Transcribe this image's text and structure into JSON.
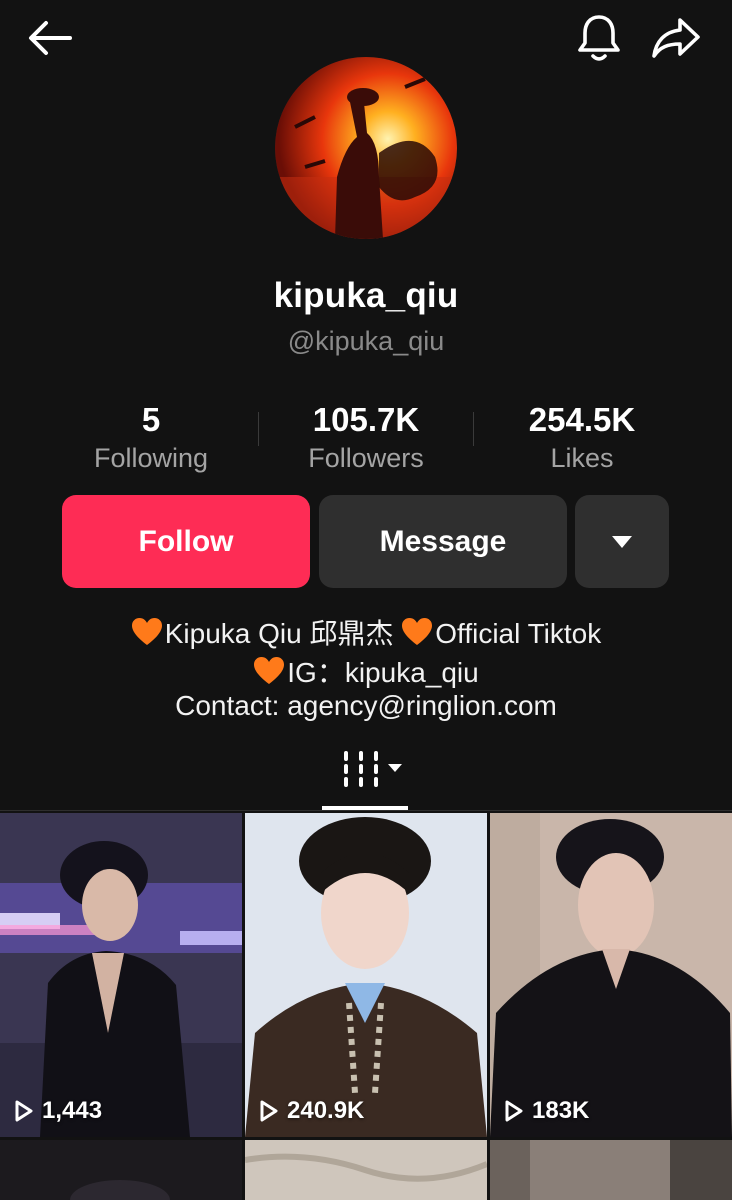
{
  "profile": {
    "display_name": "kipuka_qiu",
    "handle": "@kipuka_qiu"
  },
  "stats": [
    {
      "value": "5",
      "label": "Following"
    },
    {
      "value": "105.7K",
      "label": "Followers"
    },
    {
      "value": "254.5K",
      "label": "Likes"
    }
  ],
  "actions": {
    "follow_label": "Follow",
    "message_label": "Message"
  },
  "bio": {
    "line1": "Kipuka Qiu 邱鼎杰 ",
    "line1_tail": "Official Tiktok",
    "line2": "IG：kipuka_qiu",
    "line3": "Contact: agency@ringlion.com"
  },
  "videos": [
    {
      "views": "1,443"
    },
    {
      "views": "240.9K"
    },
    {
      "views": "183K"
    }
  ],
  "icons": {
    "back": "arrow-left-icon",
    "bell": "bell-icon",
    "share": "share-icon",
    "more": "caret-down-icon",
    "grid": "grid-icon",
    "play": "play-icon",
    "heart": "orange-heart-icon"
  },
  "colors": {
    "background": "#121212",
    "follow": "#fe2c55",
    "secondary_button": "#2f2f2f",
    "muted_text": "#8a8a8a",
    "heart": "#ff7a1a"
  }
}
